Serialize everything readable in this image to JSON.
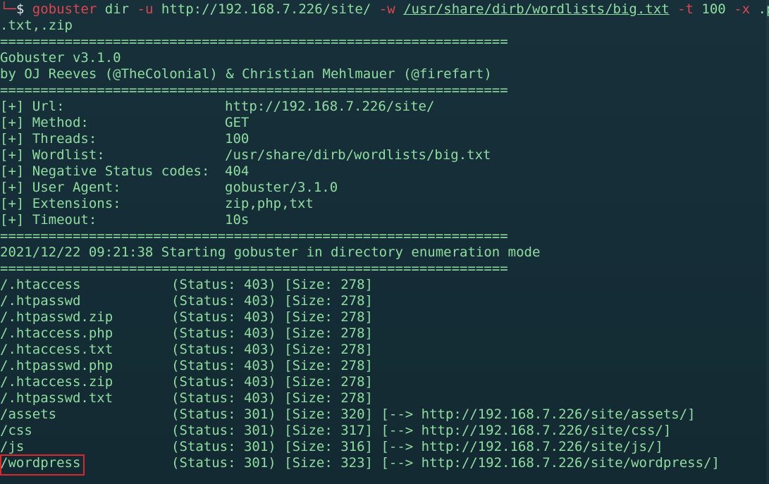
{
  "colors": {
    "background": "#152b33",
    "text_green": "#8fdd9f",
    "command_red": "#e0454f",
    "highlight_red": "#d9292e"
  },
  "command": {
    "prompt_corner": "└─",
    "prompt_symbol": "$",
    "program": "gobuster",
    "subcommand": "dir",
    "flag_u": "-u",
    "url": "http://192.168.7.226/site/",
    "flag_w": "-w",
    "wordlist": "/usr/share/dirb/wordlists/big.txt",
    "flag_t": "-t",
    "threads": "100",
    "flag_x": "-x",
    "ext_part1": ".php,",
    "ext_part2": ".txt,.zip"
  },
  "separator": "===============================================================",
  "banner": {
    "version": "Gobuster v3.1.0",
    "authors": "by OJ Reeves (@TheColonial) & Christian Mehlmauer (@firefart)"
  },
  "config": [
    {
      "key": "[+] Url:",
      "value": "http://192.168.7.226/site/"
    },
    {
      "key": "[+] Method:",
      "value": "GET"
    },
    {
      "key": "[+] Threads:",
      "value": "100"
    },
    {
      "key": "[+] Wordlist:",
      "value": "/usr/share/dirb/wordlists/big.txt"
    },
    {
      "key": "[+] Negative Status codes:",
      "value": "404"
    },
    {
      "key": "[+] User Agent:",
      "value": "gobuster/3.1.0"
    },
    {
      "key": "[+] Extensions:",
      "value": "zip,php,txt"
    },
    {
      "key": "[+] Timeout:",
      "value": "10s"
    }
  ],
  "start_message": "2021/12/22 09:21:38 Starting gobuster in directory enumeration mode",
  "results": [
    {
      "path": "/.htaccess",
      "status": "(Status: 403)",
      "size": "[Size: 278]",
      "redirect": ""
    },
    {
      "path": "/.htpasswd",
      "status": "(Status: 403)",
      "size": "[Size: 278]",
      "redirect": ""
    },
    {
      "path": "/.htpasswd.zip",
      "status": "(Status: 403)",
      "size": "[Size: 278]",
      "redirect": ""
    },
    {
      "path": "/.htaccess.php",
      "status": "(Status: 403)",
      "size": "[Size: 278]",
      "redirect": ""
    },
    {
      "path": "/.htaccess.txt",
      "status": "(Status: 403)",
      "size": "[Size: 278]",
      "redirect": ""
    },
    {
      "path": "/.htpasswd.php",
      "status": "(Status: 403)",
      "size": "[Size: 278]",
      "redirect": ""
    },
    {
      "path": "/.htaccess.zip",
      "status": "(Status: 403)",
      "size": "[Size: 278]",
      "redirect": ""
    },
    {
      "path": "/.htpasswd.txt",
      "status": "(Status: 403)",
      "size": "[Size: 278]",
      "redirect": ""
    },
    {
      "path": "/assets",
      "status": "(Status: 301)",
      "size": "[Size: 320]",
      "redirect": "[--> http://192.168.7.226/site/assets/]"
    },
    {
      "path": "/css",
      "status": "(Status: 301)",
      "size": "[Size: 317]",
      "redirect": "[--> http://192.168.7.226/site/css/]"
    },
    {
      "path": "/js",
      "status": "(Status: 301)",
      "size": "[Size: 316]",
      "redirect": "[--> http://192.168.7.226/site/js/]"
    },
    {
      "path": "/wordpress",
      "status": "(Status: 301)",
      "size": "[Size: 323]",
      "redirect": "[--> http://192.168.7.226/site/wordpress/]"
    }
  ]
}
